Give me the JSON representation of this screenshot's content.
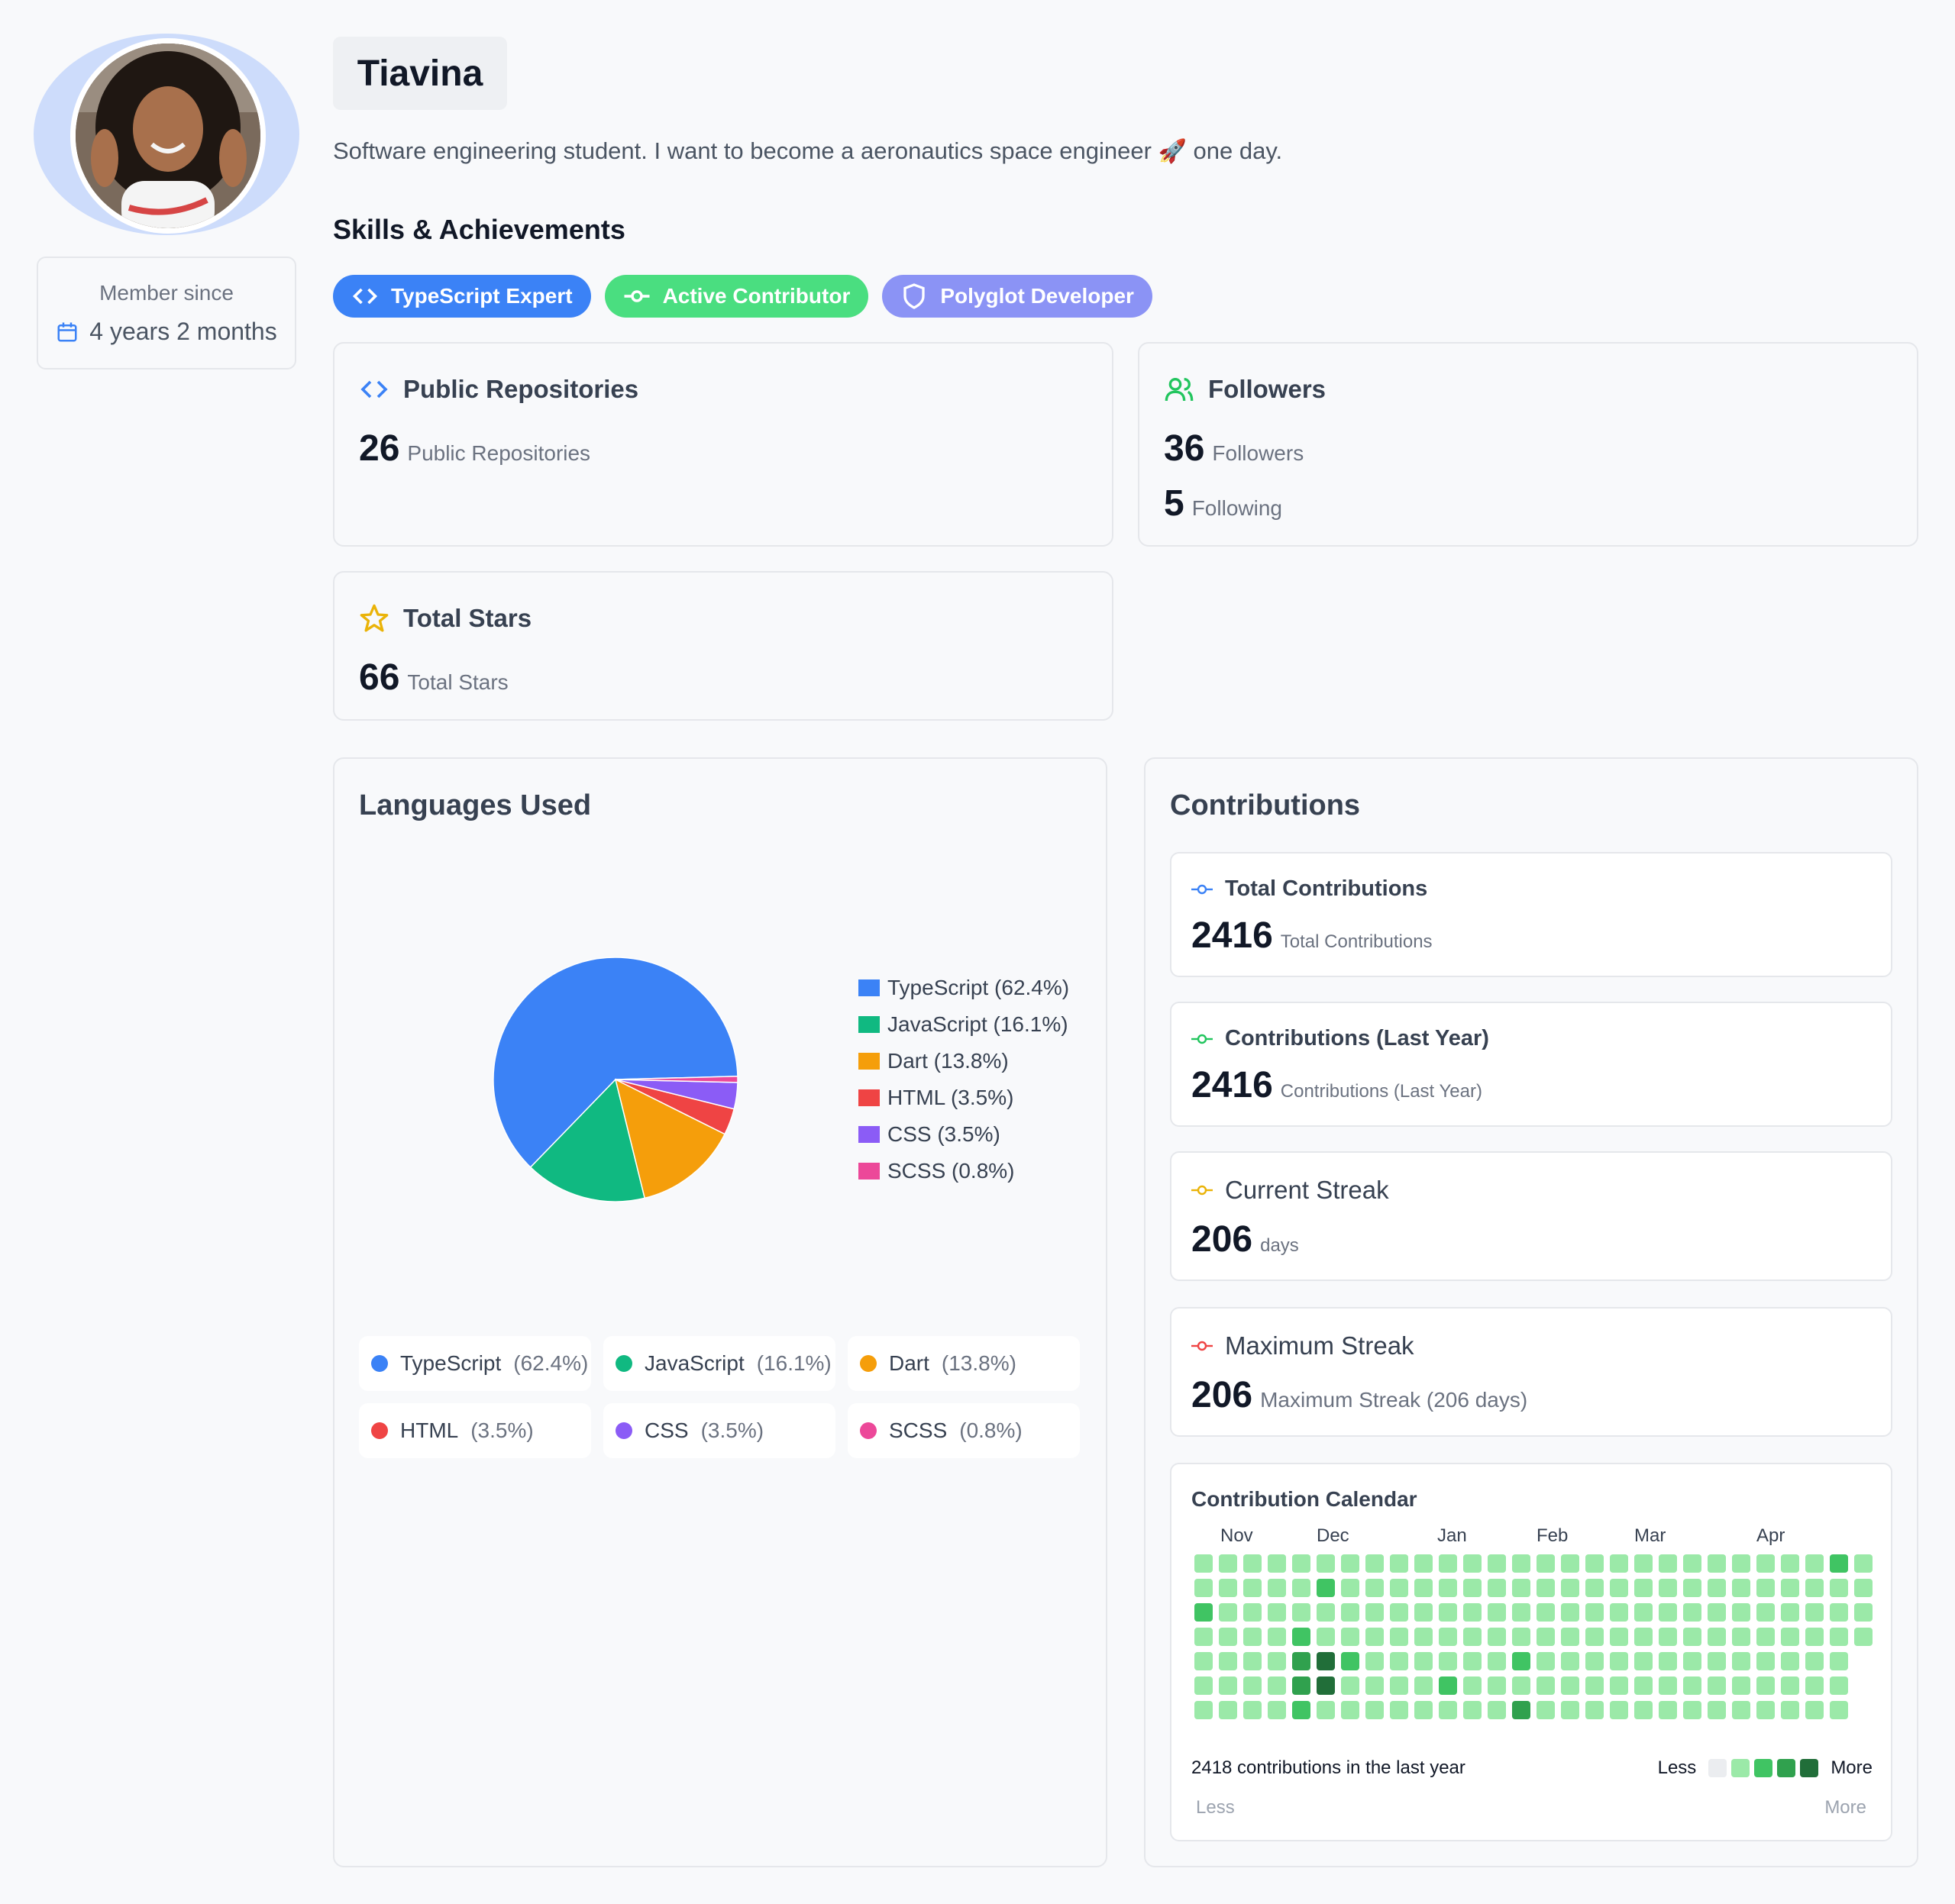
{
  "profile": {
    "name": "Tiavina",
    "bio_before": "Software engineering student. I want to become a aeronautics space engineer",
    "bio_after": "one day.",
    "member_since_label": "Member since",
    "member_since_value": "4 years 2 months"
  },
  "skills": {
    "title": "Skills & Achievements",
    "badges": [
      {
        "label": "TypeScript Expert",
        "color": "#3b82f6",
        "icon": "code-icon"
      },
      {
        "label": "Active Contributor",
        "color": "#4ade80",
        "icon": "commit-icon"
      },
      {
        "label": "Polyglot Developer",
        "color": "#8b93f5",
        "icon": "shield-icon"
      }
    ]
  },
  "stats": {
    "repos": {
      "title": "Public Repositories",
      "value": "26",
      "label": "Public Repositories"
    },
    "followers": {
      "title": "Followers",
      "followers_value": "36",
      "followers_label": "Followers",
      "following_value": "5",
      "following_label": "Following"
    },
    "stars": {
      "title": "Total Stars",
      "value": "66",
      "label": "Total Stars"
    }
  },
  "languages": {
    "title": "Languages Used",
    "legend": [
      "TypeScript (62.4%)",
      "JavaScript (16.1%)",
      "Dart (13.8%)",
      "HTML (3.5%)",
      "CSS (3.5%)",
      "SCSS (0.8%)"
    ],
    "chips": [
      {
        "name": "TypeScript",
        "pct": "(62.4%)"
      },
      {
        "name": "JavaScript",
        "pct": "(16.1%)"
      },
      {
        "name": "Dart",
        "pct": "(13.8%)"
      },
      {
        "name": "HTML",
        "pct": "(3.5%)"
      },
      {
        "name": "CSS",
        "pct": "(3.5%)"
      },
      {
        "name": "SCSS",
        "pct": "(0.8%)"
      }
    ]
  },
  "chart_data": {
    "type": "pie",
    "title": "Languages Used",
    "categories": [
      "TypeScript",
      "JavaScript",
      "Dart",
      "HTML",
      "CSS",
      "SCSS"
    ],
    "values": [
      62.4,
      16.1,
      13.8,
      3.5,
      3.5,
      0.8
    ],
    "colors": [
      "#3b82f6",
      "#10b981",
      "#f59e0b",
      "#ef4444",
      "#8b5cf6",
      "#ec4899"
    ],
    "legend_position": "right"
  },
  "contributions": {
    "title": "Contributions",
    "total": {
      "title": "Total Contributions",
      "value": "2416",
      "label": "Total Contributions",
      "color": "#3b82f6"
    },
    "last_year": {
      "title": "Contributions (Last Year)",
      "value": "2416",
      "label": "Contributions (Last Year)",
      "color": "#22c55e"
    },
    "current_streak": {
      "title": "Current Streak",
      "value": "206",
      "label": "days",
      "color": "#eab308"
    },
    "max_streak": {
      "title": "Maximum Streak",
      "value": "206",
      "label": "Maximum Streak (206 days)",
      "color": "#ef4444"
    }
  },
  "calendar": {
    "title": "Contribution Calendar",
    "months": [
      "Nov",
      "Dec",
      "Jan",
      "Feb",
      "Mar",
      "Apr"
    ],
    "footer": "2418 contributions in the last year",
    "less": "Less",
    "more": "More",
    "less_bottom": "Less",
    "more_bottom": "More",
    "level_colors": [
      "#ebedf0",
      "#9be9a8",
      "#40c463",
      "#30a14e",
      "#216e39"
    ],
    "columns": 28,
    "rows": 7,
    "cells": [
      [
        1,
        1,
        1,
        1,
        1,
        1,
        1,
        1,
        1,
        1,
        1,
        1,
        1,
        1,
        1,
        1,
        1,
        1,
        1,
        1,
        1,
        1,
        1,
        1,
        1,
        1,
        2,
        1
      ],
      [
        1,
        1,
        1,
        1,
        1,
        2,
        1,
        1,
        1,
        1,
        1,
        1,
        1,
        1,
        1,
        1,
        1,
        1,
        1,
        1,
        1,
        1,
        1,
        1,
        1,
        1,
        1,
        1
      ],
      [
        2,
        1,
        1,
        1,
        1,
        1,
        1,
        1,
        1,
        1,
        1,
        1,
        1,
        1,
        1,
        1,
        1,
        1,
        1,
        1,
        1,
        1,
        1,
        1,
        1,
        1,
        1,
        1
      ],
      [
        1,
        1,
        1,
        1,
        2,
        1,
        1,
        1,
        1,
        1,
        1,
        1,
        1,
        1,
        1,
        1,
        1,
        1,
        1,
        1,
        1,
        1,
        1,
        1,
        1,
        1,
        1,
        1
      ],
      [
        1,
        1,
        1,
        1,
        3,
        4,
        2,
        1,
        1,
        1,
        1,
        1,
        1,
        2,
        1,
        1,
        1,
        1,
        1,
        1,
        1,
        1,
        1,
        1,
        1,
        1,
        1,
        0
      ],
      [
        1,
        1,
        1,
        1,
        3,
        4,
        1,
        1,
        1,
        1,
        2,
        1,
        1,
        1,
        1,
        1,
        1,
        1,
        1,
        1,
        1,
        1,
        1,
        1,
        1,
        1,
        1,
        0
      ],
      [
        1,
        1,
        1,
        1,
        2,
        1,
        1,
        1,
        1,
        1,
        1,
        1,
        1,
        3,
        1,
        1,
        1,
        1,
        1,
        1,
        1,
        1,
        1,
        1,
        1,
        1,
        1,
        0
      ]
    ]
  }
}
